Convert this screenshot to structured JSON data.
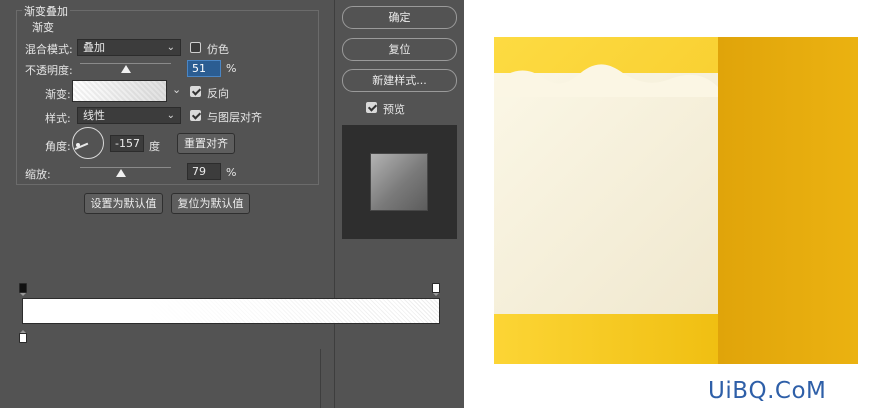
{
  "dialog": {
    "group_title": "渐变叠加",
    "sub_title": "渐变",
    "blend_mode": {
      "label": "混合模式:",
      "value": "叠加"
    },
    "dither": {
      "label": "仿色",
      "checked": false
    },
    "opacity": {
      "label": "不透明度:",
      "value": "51",
      "unit": "%",
      "fraction": 0.51
    },
    "gradient": {
      "label": "渐变:",
      "reverse_label": "反向",
      "reverse_checked": true
    },
    "style": {
      "label": "样式:",
      "value": "线性",
      "align_label": "与图层对齐",
      "align_checked": true
    },
    "angle": {
      "label": "角度:",
      "value": "-157",
      "unit": "度",
      "reset_label": "重置对齐"
    },
    "scale": {
      "label": "缩放:",
      "value": "79",
      "unit": "%",
      "fraction": 0.79
    },
    "set_default_label": "设置为默认值",
    "reset_default_label": "复位为默认值"
  },
  "side_buttons": {
    "ok": "确定",
    "reset": "复位",
    "new_style": "新建样式...",
    "preview_label": "预览",
    "preview_checked": true
  },
  "gradient_editor": {
    "colors": {
      "start": "#ffffff",
      "end": "#ffffff"
    }
  },
  "artwork": {
    "colors": {
      "yellow": "#fddb42",
      "cream": "#fbf7e6",
      "dark_yellow": "#e0a40a"
    }
  },
  "watermark": "UiBQ.CoM"
}
